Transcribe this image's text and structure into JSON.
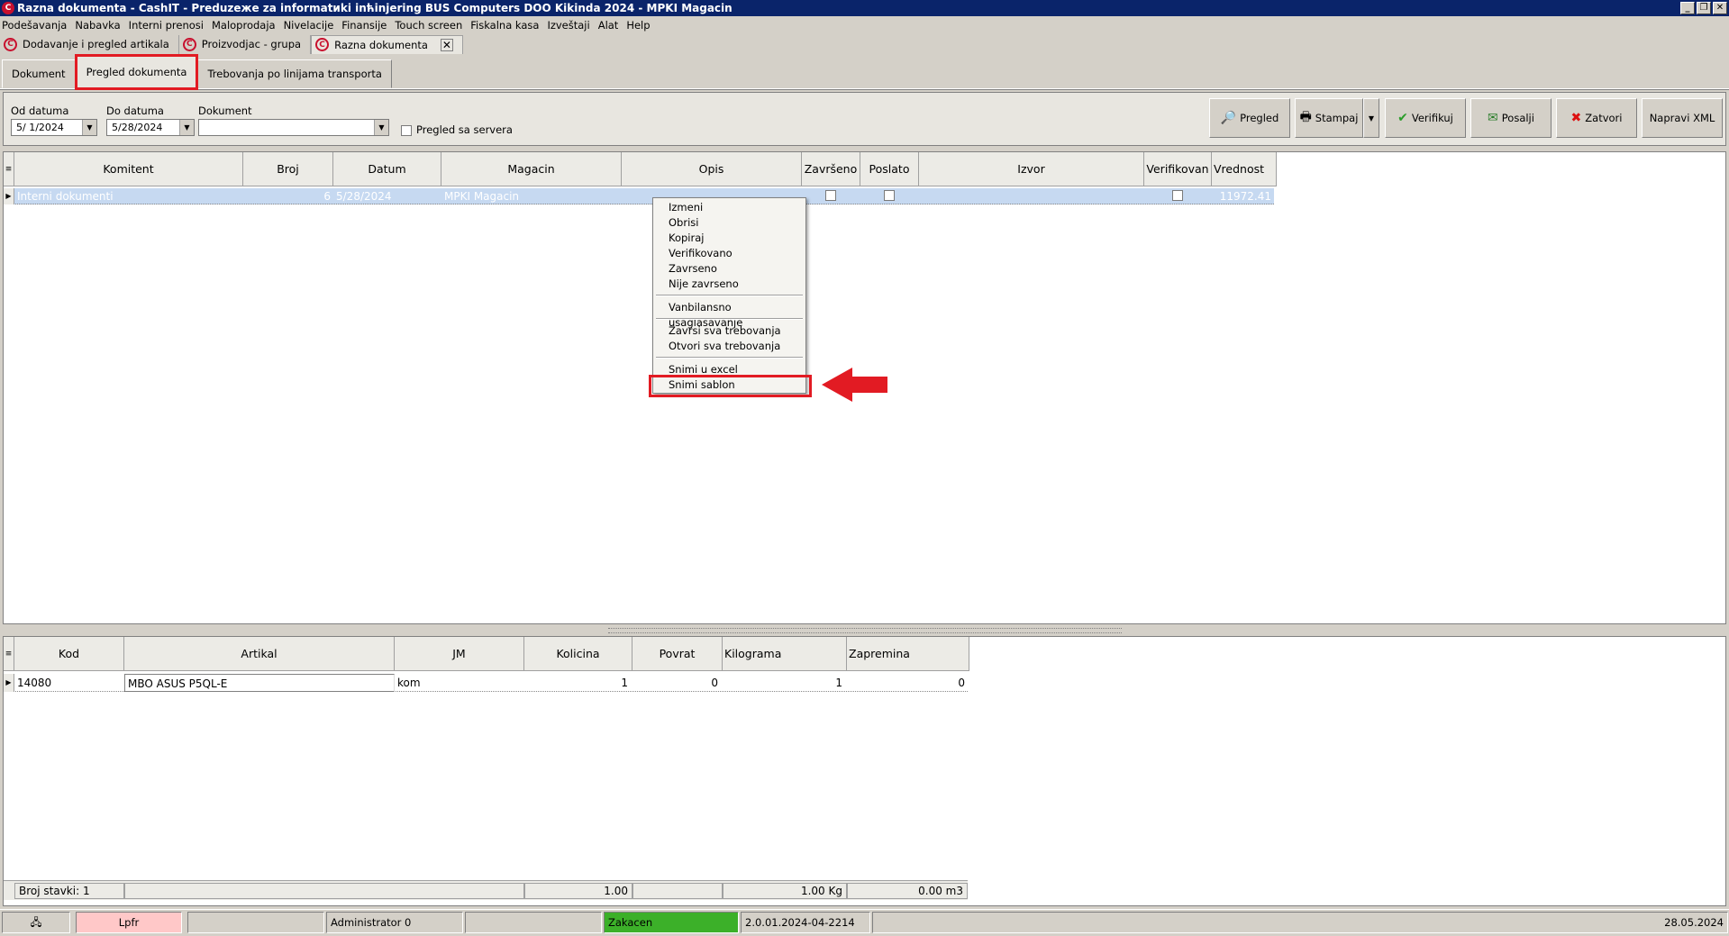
{
  "window": {
    "title": "Razna dokumenta - CashIT - Preduzeжe za informatиki inћinjering BUS Computers DOO Kikinda 2024 - MPKI Magacin",
    "controls": [
      "_",
      "❐",
      "✕"
    ]
  },
  "menu": [
    "Podešavanja",
    "Nabavka",
    "Interni prenosi",
    "Maloprodaja",
    "Nivelacije",
    "Finansije",
    "Touch screen",
    "Fiskalna kasa",
    "Izveštaji",
    "Alat",
    "Help"
  ],
  "doc_tabs": [
    {
      "label": "Dodavanje i pregled artikala",
      "active": false
    },
    {
      "label": "Proizvodjac - grupa",
      "active": false
    },
    {
      "label": "Razna dokumenta",
      "active": true
    }
  ],
  "inner_tabs": [
    {
      "label": "Dokument",
      "active": false
    },
    {
      "label": "Pregled dokumenta",
      "active": true
    },
    {
      "label": "Trebovanja po linijama transporta",
      "active": false
    }
  ],
  "filters": {
    "od_datuma_label": "Od datuma",
    "od_datuma_value": "5/ 1/2024",
    "do_datuma_label": "Do datuma",
    "do_datuma_value": "5/28/2024",
    "dokument_label": "Dokument",
    "dokument_value": "",
    "pregled_sa_servera_label": "Pregled sa servera"
  },
  "toolbar": {
    "pregled": "Pregled",
    "stampaj": "Stampaj",
    "verifikuj": "Verifikuj",
    "posalji": "Posalji",
    "zatvori": "Zatvori",
    "napravi_xml": "Napravi XML"
  },
  "grid1": {
    "columns": [
      "Komitent",
      "Broj",
      "Datum",
      "Magacin",
      "Opis",
      "Završeno",
      "Poslato",
      "Izvor",
      "Verifikovan",
      "Vrednost"
    ],
    "rows": [
      {
        "komitent": "Interni dokumenti",
        "broj": "6",
        "datum": "5/28/2024",
        "magacin": "MPKI Magacin",
        "opis": "",
        "izvor": "",
        "vrednost": "11972.41"
      }
    ]
  },
  "context_menu": {
    "items": [
      "Izmeni",
      "Obrisi",
      "Kopiraj",
      "Verifikovano",
      "Zavrseno",
      "Nije zavrseno",
      "Vanbilansno usaglasavanje",
      "Zavrsi sva trebovanja",
      "Otvori sva trebovanja",
      "Snimi u excel",
      "Snimi sablon"
    ],
    "highlighted": "Snimi sablon"
  },
  "grid2": {
    "columns": [
      "Kod",
      "Artikal",
      "JM",
      "Kolicina",
      "Povrat",
      "Kilograma",
      "Zapremina"
    ],
    "rows": [
      {
        "kod": "14080",
        "artikal": "MBO ASUS P5QL-E",
        "jm": "kom",
        "kolicina": "1",
        "povrat": "0",
        "kilograma": "1",
        "zapremina": "0"
      }
    ],
    "footer": {
      "broj_stavki": "Broj stavki: 1",
      "kolicina_total": "1.00",
      "kilograma_total": "1.00 Kg",
      "zapremina_total": "0.00 m3"
    }
  },
  "statusbar": {
    "lpfr": "Lpfr",
    "user": "Administrator 0",
    "status": "Zakacen",
    "version": "2.0.01.2024-04-2214",
    "date": "28.05.2024"
  },
  "colors": {
    "highlight_red": "#e21b23",
    "status_green": "#3cb029",
    "lpfr_pink": "#ffc8c8",
    "row_selected": "#c6d9f1",
    "titlebar": "#0a246a"
  }
}
